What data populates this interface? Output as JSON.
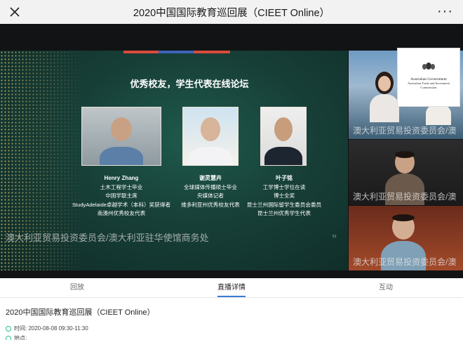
{
  "topbar": {
    "title": "2020中国国际教育巡回展（CIEET Online）",
    "close_icon": "close-icon",
    "more_icon": "more-icon",
    "more_glyph": "···"
  },
  "slide": {
    "heading": "优秀校友，学生代表在线论坛",
    "speakers": [
      {
        "name": "Henry Zhang",
        "lines": [
          "土木工程学士毕业",
          "中国学联主席",
          "StudyAdelaide卓越学术（本科）奖获得者",
          "南澳州优秀校友代表"
        ]
      },
      {
        "name": "谢灵慧卉",
        "lines": [
          "全球媒体传播硕士毕业",
          "央媒体记者",
          "维多利亚州优秀校友代表"
        ]
      },
      {
        "name": "叶子铭",
        "lines": [
          "工学博士学位在读",
          "博士全奖",
          "昆士兰州国际留学生委员会委员",
          "昆士兰州优秀学生代表"
        ]
      }
    ],
    "watermark": "澳大利亚贸易投资委员会/澳大利亚驻华使馆商务处",
    "page_no": "51"
  },
  "thumbnails": [
    {
      "caption": "澳大利亚贸易投资委员会/澳"
    },
    {
      "caption": "澳大利亚贸易投资委员会/澳"
    },
    {
      "caption": "澳大利亚贸易投资委员会/澳"
    }
  ],
  "logo_card": {
    "line1": "Australian Government",
    "line2": "Australian Trade and Investment Commission"
  },
  "tabs": [
    {
      "label": "回放",
      "active": false
    },
    {
      "label": "直播详情",
      "active": true
    },
    {
      "label": "互动",
      "active": false
    }
  ],
  "details": {
    "title": "2020中国国际教育巡回展（CIEET Online）",
    "time": "时间: 2020-08-08 09:30-11:30",
    "location": "地点:"
  },
  "colors": {
    "accent": "#3a7bd5",
    "detail_icon": "#2cbf8a",
    "slide_bg": "#173f37"
  }
}
